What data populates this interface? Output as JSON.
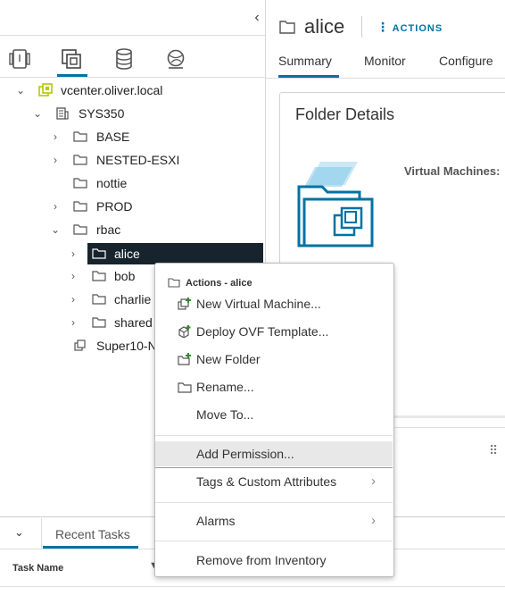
{
  "navigator": {
    "collapse_glyph": "‹",
    "tabs": [
      {
        "name": "hosts-and-clusters-icon",
        "active": false
      },
      {
        "name": "vms-and-templates-icon",
        "active": true
      },
      {
        "name": "storage-icon",
        "active": false
      },
      {
        "name": "networking-icon",
        "active": false
      }
    ],
    "tree": [
      {
        "label": "vcenter.oliver.local",
        "icon": "vcenter-icon",
        "expanded": true
      },
      {
        "label": "SYS350",
        "icon": "datacenter-icon",
        "expanded": true
      },
      {
        "label": "BASE",
        "icon": "folder-icon"
      },
      {
        "label": "NESTED-ESXI",
        "icon": "folder-icon"
      },
      {
        "label": "nottie",
        "icon": "folder-icon"
      },
      {
        "label": "PROD",
        "icon": "folder-icon"
      },
      {
        "label": "rbac",
        "icon": "folder-icon",
        "expanded": true
      },
      {
        "label": "alice",
        "icon": "folder-icon",
        "selected": true
      },
      {
        "label": "bob",
        "icon": "folder-icon"
      },
      {
        "label": "charlie",
        "icon": "folder-icon"
      },
      {
        "label": "shared",
        "icon": "folder-icon"
      },
      {
        "label": "Super10-N",
        "icon": "vm-icon"
      }
    ]
  },
  "header": {
    "title": "alice",
    "actions_label": "ACTIONS",
    "tabs": [
      "Summary",
      "Monitor",
      "Configure"
    ],
    "active_tab": "Summary"
  },
  "folder_details": {
    "title": "Folder Details",
    "vm_label": "Virtual Machines:"
  },
  "context_menu": {
    "header": "Actions - alice",
    "items": [
      {
        "label": "New Virtual Machine...",
        "icon": "new-vm-icon"
      },
      {
        "label": "Deploy OVF Template...",
        "icon": "deploy-ovf-icon"
      },
      {
        "label": "New Folder",
        "icon": "new-folder-icon"
      },
      {
        "label": "Rename...",
        "icon": "rename-folder-icon"
      },
      {
        "label": "Move To...",
        "icon": ""
      },
      {
        "label": "Add Permission...",
        "icon": "",
        "highlighted": true
      },
      {
        "label": "Tags & Custom Attributes",
        "submenu": true
      },
      {
        "label": "Alarms",
        "submenu": true
      },
      {
        "label": "Remove from Inventory"
      }
    ]
  },
  "bottom_panel": {
    "tab_label": "Recent Tasks",
    "columns": [
      "Task Name"
    ]
  },
  "colors": {
    "accent": "#0072a3",
    "selection": "#17242d",
    "vcenter_icon": "#b5c800"
  }
}
